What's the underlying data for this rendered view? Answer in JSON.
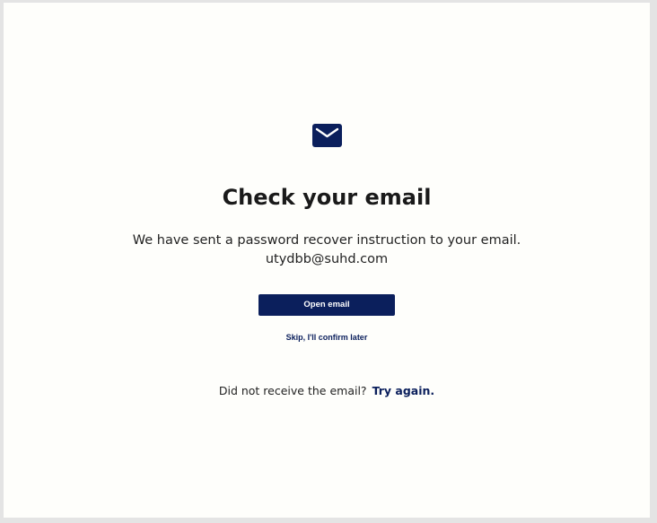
{
  "icon": "mail-envelope-icon",
  "title": "Check your email",
  "message": {
    "line1": "We have sent a password recover instruction to your email.",
    "email": "utydbb@suhd.com"
  },
  "actions": {
    "open_email_label": "Open email",
    "skip_label": "Skip, I'll confirm later"
  },
  "retry": {
    "prompt": "Did not receive the email?",
    "link_label": "Try again."
  },
  "colors": {
    "accent": "#0b1f5c",
    "background": "#fefefb",
    "frame": "#e4e4e4",
    "text": "#1a1a1a"
  }
}
